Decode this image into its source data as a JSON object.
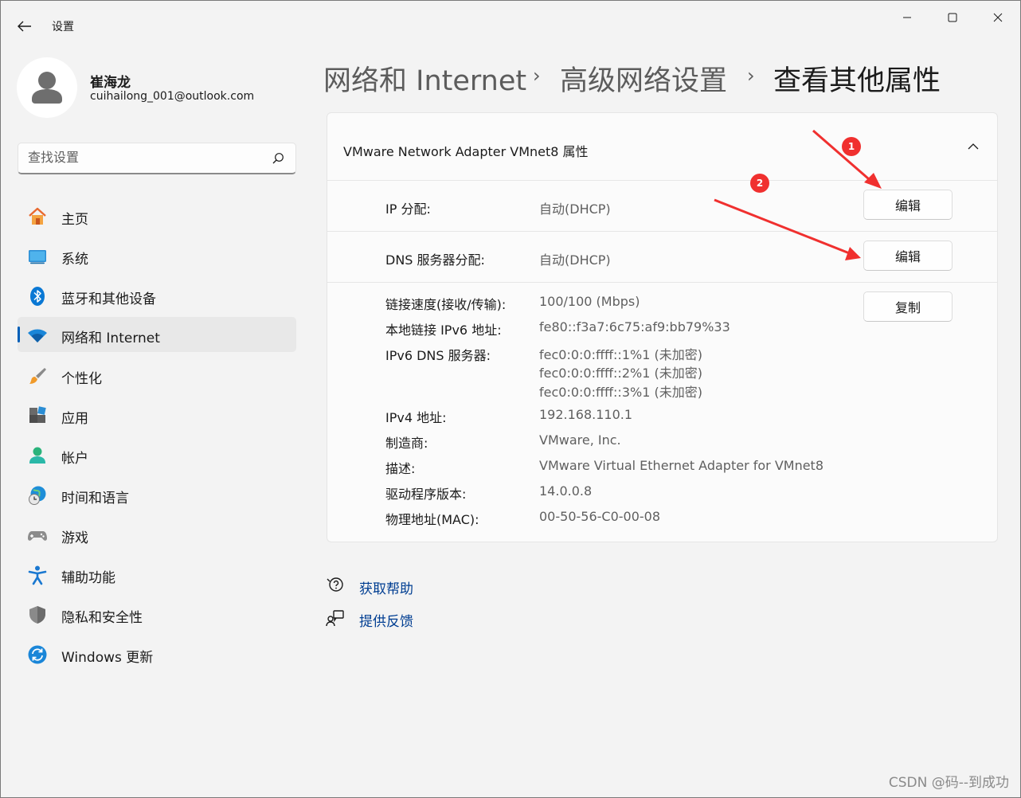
{
  "window": {
    "app_title": "设置",
    "back_icon": "back-arrow-icon",
    "minimize_icon": "minimize-icon",
    "maximize_icon": "maximize-icon",
    "close_icon": "close-icon"
  },
  "user": {
    "name": "崔海龙",
    "email": "cuihailong_001@outlook.com"
  },
  "search": {
    "placeholder": "查找设置"
  },
  "sidebar": {
    "items": [
      {
        "label": "主页",
        "icon": "home-icon"
      },
      {
        "label": "系统",
        "icon": "system-icon"
      },
      {
        "label": "蓝牙和其他设备",
        "icon": "bluetooth-icon"
      },
      {
        "label": "网络和 Internet",
        "icon": "wifi-icon",
        "active": true
      },
      {
        "label": "个性化",
        "icon": "brush-icon"
      },
      {
        "label": "应用",
        "icon": "apps-icon"
      },
      {
        "label": "帐户",
        "icon": "account-icon"
      },
      {
        "label": "时间和语言",
        "icon": "globe-clock-icon"
      },
      {
        "label": "游戏",
        "icon": "gamepad-icon"
      },
      {
        "label": "辅助功能",
        "icon": "accessibility-icon"
      },
      {
        "label": "隐私和安全性",
        "icon": "shield-icon"
      },
      {
        "label": "Windows 更新",
        "icon": "update-icon"
      }
    ]
  },
  "breadcrumb": {
    "items": [
      "网络和 Internet",
      "高级网络设置",
      "查看其他属性"
    ],
    "separator": "›"
  },
  "card": {
    "title": "VMware Network Adapter VMnet8 属性",
    "ip_assignment": {
      "label": "IP 分配:",
      "value": "自动(DHCP)",
      "button": "编辑"
    },
    "dns_assignment": {
      "label": "DNS 服务器分配:",
      "value": "自动(DHCP)",
      "button": "编辑"
    },
    "copy_button": "复制",
    "properties": {
      "link_speed": {
        "label": "链接速度(接收/传输):",
        "value": "100/100 (Mbps)"
      },
      "ipv6_local": {
        "label": "本地链接 IPv6 地址:",
        "value": "fe80::f3a7:6c75:af9:bb79%33"
      },
      "ipv6_dns": {
        "label": "IPv6 DNS 服务器:",
        "values": [
          "fec0:0:0:ffff::1%1 (未加密)",
          "fec0:0:0:ffff::2%1 (未加密)",
          "fec0:0:0:ffff::3%1 (未加密)"
        ]
      },
      "ipv4": {
        "label": "IPv4 地址:",
        "value": "192.168.110.1"
      },
      "manufacturer": {
        "label": "制造商:",
        "value": "VMware, Inc."
      },
      "description": {
        "label": "描述:",
        "value": "VMware Virtual Ethernet Adapter for VMnet8"
      },
      "driver_version": {
        "label": "驱动程序版本:",
        "value": "14.0.0.8"
      },
      "mac": {
        "label": "物理地址(MAC):",
        "value": "00-50-56-C0-00-08"
      }
    }
  },
  "help": {
    "get_help": "获取帮助",
    "feedback": "提供反馈"
  },
  "annotations": {
    "badge1": "1",
    "badge2": "2",
    "arrow_color": "#f0302f"
  },
  "watermark": "CSDN @码--到成功",
  "colors": {
    "accent": "#005fb8",
    "link": "#003e92",
    "background": "#f3f3f3",
    "card": "#fbfbfb"
  }
}
